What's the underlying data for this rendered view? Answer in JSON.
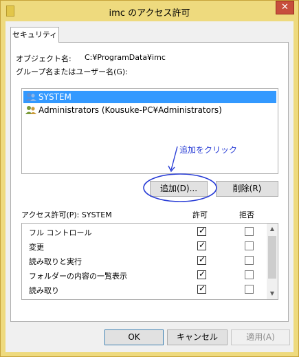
{
  "window": {
    "title": "imc のアクセス許可",
    "close_glyph": "✕"
  },
  "tabs": [
    {
      "label": "セキュリティ"
    }
  ],
  "object": {
    "label": "オブジェクト名:",
    "value": "C:¥ProgramData¥imc"
  },
  "group_label": "グループ名またはユーザー名(G):",
  "users": [
    {
      "name": "SYSTEM",
      "selected": true
    },
    {
      "name": "Administrators (Kousuke-PC¥Administrators)",
      "selected": false
    }
  ],
  "annotation": {
    "text": "追加をクリック",
    "color": "#2b3fd6"
  },
  "buttons": {
    "add": "追加(D)...",
    "remove": "削除(R)",
    "ok": "OK",
    "cancel": "キャンセル",
    "apply": "適用(A)"
  },
  "permissions": {
    "label": "アクセス許可(P): SYSTEM",
    "allow_header": "許可",
    "deny_header": "拒否",
    "items": [
      {
        "name": "フル コントロール",
        "allow": true,
        "deny": false
      },
      {
        "name": "変更",
        "allow": true,
        "deny": false
      },
      {
        "name": "読み取りと実行",
        "allow": true,
        "deny": false
      },
      {
        "name": "フォルダーの内容の一覧表示",
        "allow": true,
        "deny": false
      },
      {
        "name": "読み取り",
        "allow": true,
        "deny": false
      }
    ]
  },
  "colors": {
    "selection": "#3399ff",
    "titlebar": "#eeda7e",
    "close": "#c74f3c"
  }
}
